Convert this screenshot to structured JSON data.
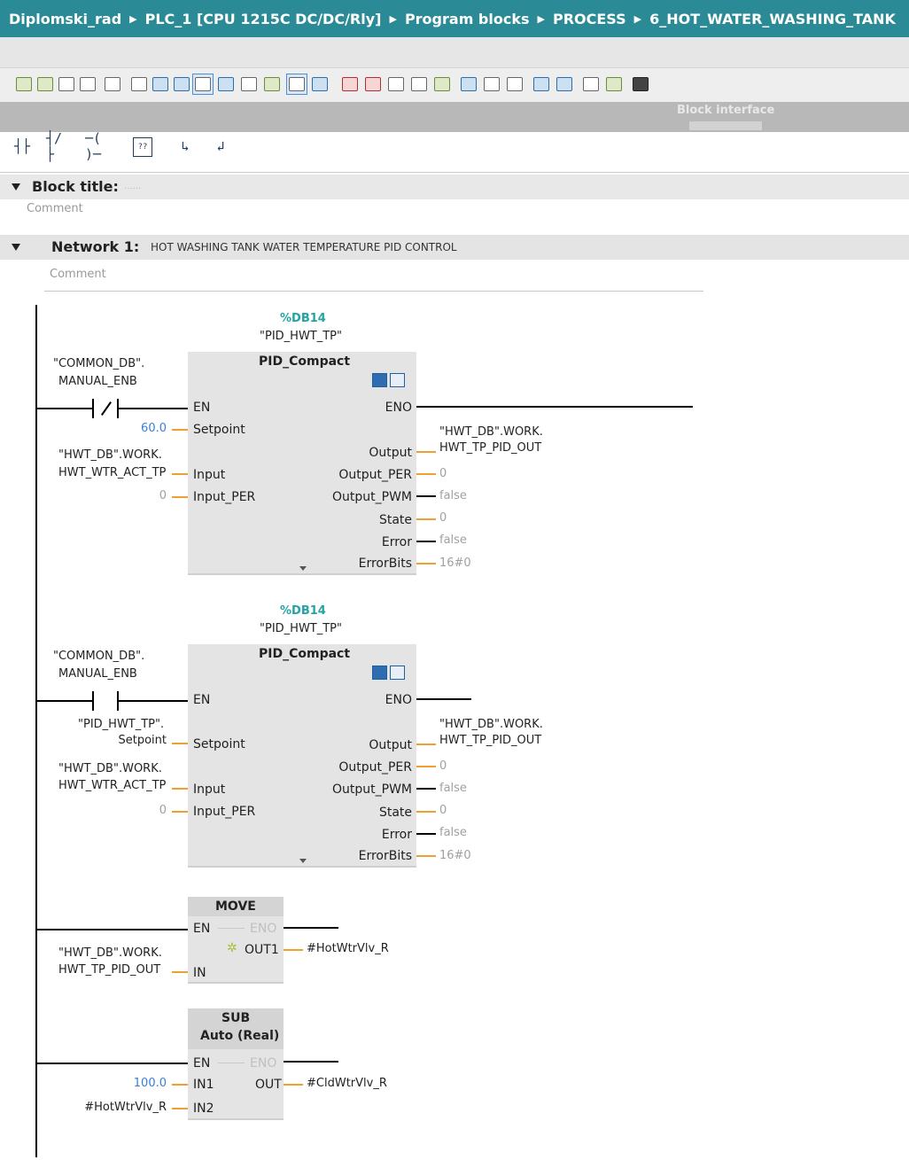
{
  "breadcrumb": [
    "Diplomski_rad",
    "PLC_1 [CPU 1215C DC/DC/Rly]",
    "Program blocks",
    "PROCESS",
    "6_HOT_WATER_WASHING_TANK"
  ],
  "block_interface_label": "Block interface",
  "ladder_elements": [
    "normally-open-contact",
    "normally-closed-contact",
    "coil",
    "empty-box",
    "open-branch",
    "close-branch"
  ],
  "ladder_element_glyphs": [
    "┤├",
    "┤/├",
    "─( )─",
    "??",
    "↳",
    "↲"
  ],
  "block_title_label": "Block title:",
  "block_title_value": "......",
  "block_comment": "Comment",
  "network": {
    "label": "Network 1:",
    "title": "HOT WASHING TANK WATER TEMPERATURE PID CONTROL",
    "comment": "Comment"
  },
  "pid1": {
    "db": "%DB14",
    "db_name": "\"PID_HWT_TP\"",
    "title": "PID_Compact",
    "contact_tag_1": "\"COMMON_DB\".",
    "contact_tag_2": "MANUAL_ENB",
    "inputs": {
      "en": "EN",
      "setpoint": "Setpoint",
      "input": "Input",
      "input_per": "Input_PER"
    },
    "outputs": {
      "eno": "ENO",
      "output": "Output",
      "output_per": "Output_PER",
      "output_pwm": "Output_PWM",
      "state": "State",
      "error": "Error",
      "errorbits": "ErrorBits"
    },
    "setpoint_val": "60.0",
    "input_tag_1": "\"HWT_DB\".WORK.",
    "input_tag_2": "HWT_WTR_ACT_TP",
    "input_per_val": "0",
    "output_tag_1": "\"HWT_DB\".WORK.",
    "output_tag_2": "HWT_TP_PID_OUT",
    "output_per_val": "0",
    "output_pwm_val": "false",
    "state_val": "0",
    "error_val": "false",
    "errorbits_val": "16#0"
  },
  "pid2": {
    "db": "%DB14",
    "db_name": "\"PID_HWT_TP\"",
    "title": "PID_Compact",
    "contact_tag_1": "\"COMMON_DB\".",
    "contact_tag_2": "MANUAL_ENB",
    "inputs": {
      "en": "EN",
      "setpoint": "Setpoint",
      "input": "Input",
      "input_per": "Input_PER"
    },
    "outputs": {
      "eno": "ENO",
      "output": "Output",
      "output_per": "Output_PER",
      "output_pwm": "Output_PWM",
      "state": "State",
      "error": "Error",
      "errorbits": "ErrorBits"
    },
    "setpoint_tag_1": "\"PID_HWT_TP\".",
    "setpoint_tag_2": "Setpoint",
    "input_tag_1": "\"HWT_DB\".WORK.",
    "input_tag_2": "HWT_WTR_ACT_TP",
    "input_per_val": "0",
    "output_tag_1": "\"HWT_DB\".WORK.",
    "output_tag_2": "HWT_TP_PID_OUT",
    "output_per_val": "0",
    "output_pwm_val": "false",
    "state_val": "0",
    "error_val": "false",
    "errorbits_val": "16#0"
  },
  "move": {
    "title": "MOVE",
    "en": "EN",
    "eno": "ENO",
    "out1": "OUT1",
    "in": "IN",
    "in_tag_1": "\"HWT_DB\".WORK.",
    "in_tag_2": "HWT_TP_PID_OUT",
    "out_tag": "#HotWtrVlv_R"
  },
  "sub": {
    "title_1": "SUB",
    "title_2": "Auto (Real)",
    "en": "EN",
    "eno": "ENO",
    "in1": "IN1",
    "in2": "IN2",
    "out": "OUT",
    "in1_val": "100.0",
    "in2_tag": "#HotWtrVlv_R",
    "out_tag": "#CldWtrVlv_R"
  }
}
